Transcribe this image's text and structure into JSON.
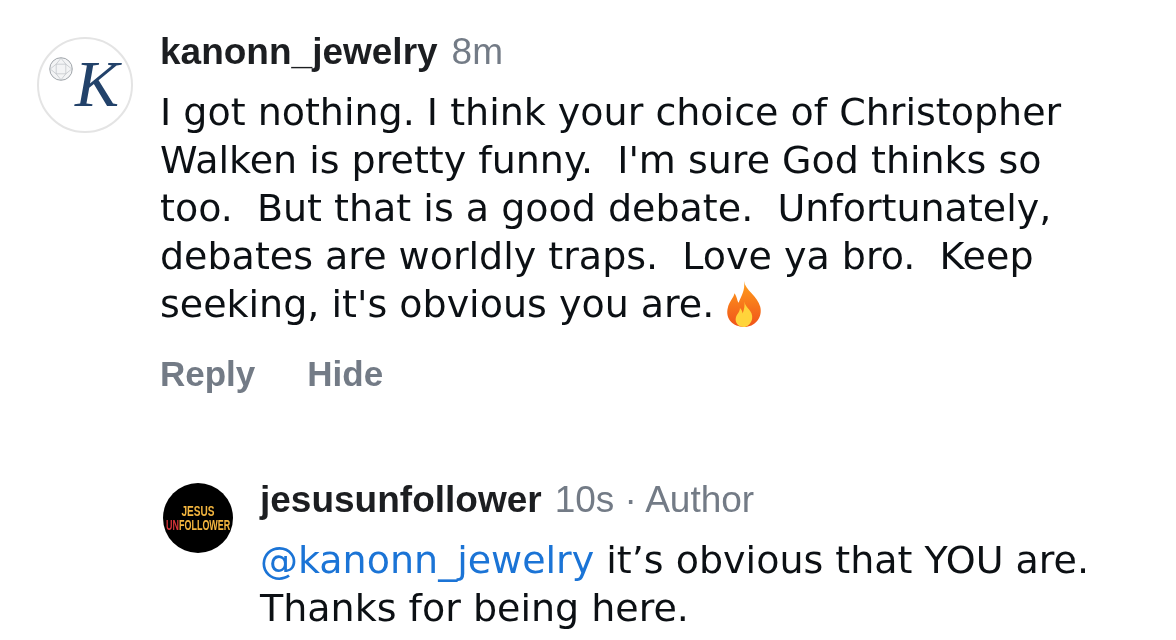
{
  "comments": [
    {
      "username": "kanonn_jewelry",
      "meta": "8m",
      "avatar": {
        "kind": "monogram",
        "letter": "K"
      },
      "text": "I got nothing. I think your choice of Christopher Walken is pretty funny.  I'm sure God thinks so too.  But that is a good debate.  Unfortunately, debates are worldly traps.  Love ya bro.  Keep seeking, it's obvious you are.",
      "has_emoji": true,
      "actions": [
        "Reply",
        "Hide"
      ],
      "replies": [
        {
          "username": "jesusunfollower",
          "meta": "10s · Author",
          "avatar": {
            "kind": "logo",
            "line_1": "JESUS",
            "line_2_accent": "UN",
            "line_2": "FOLLOWER"
          },
          "mention": "@kanonn_jewelry",
          "text": "it’s obvious that YOU are. Thanks for being here."
        }
      ]
    }
  ]
}
